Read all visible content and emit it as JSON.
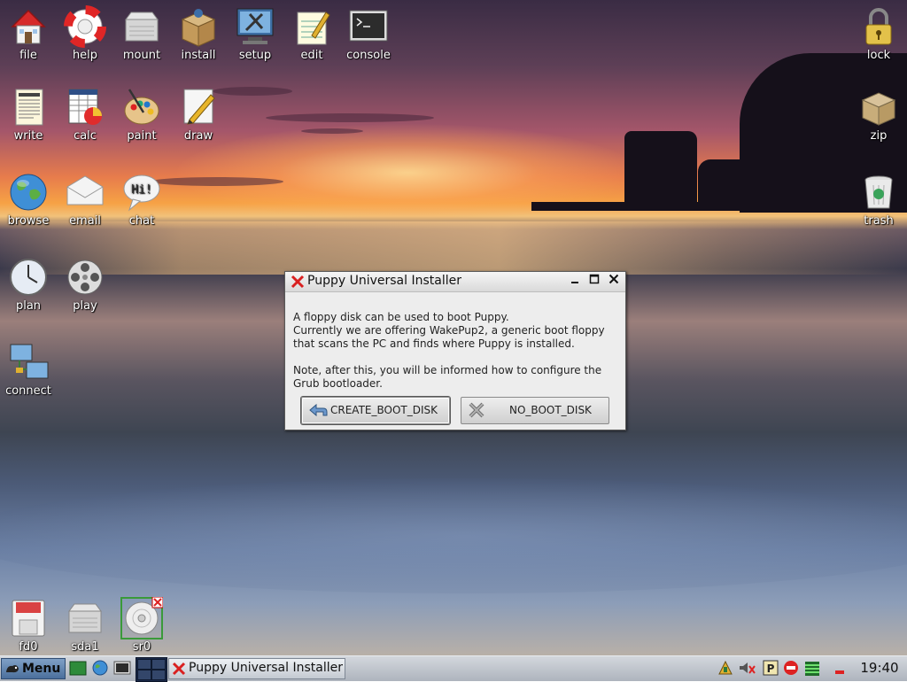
{
  "desktop": {
    "icons": [
      {
        "label": "file",
        "icon": "home-icon"
      },
      {
        "label": "help",
        "icon": "lifebuoy-icon"
      },
      {
        "label": "mount",
        "icon": "drive-icon"
      },
      {
        "label": "install",
        "icon": "package-icon"
      },
      {
        "label": "setup",
        "icon": "setup-icon"
      },
      {
        "label": "edit",
        "icon": "notepad-icon"
      },
      {
        "label": "console",
        "icon": "terminal-icon"
      },
      {
        "label": "lock",
        "icon": "padlock-icon"
      },
      {
        "label": "write",
        "icon": "document-icon"
      },
      {
        "label": "calc",
        "icon": "spreadsheet-icon"
      },
      {
        "label": "paint",
        "icon": "palette-icon"
      },
      {
        "label": "draw",
        "icon": "pencil-icon"
      },
      {
        "label": "zip",
        "icon": "box-icon"
      },
      {
        "label": "browse",
        "icon": "globe-icon"
      },
      {
        "label": "email",
        "icon": "envelope-icon"
      },
      {
        "label": "chat",
        "icon": "speech-bubble-icon"
      },
      {
        "label": "trash",
        "icon": "trash-icon"
      },
      {
        "label": "plan",
        "icon": "clock-icon"
      },
      {
        "label": "play",
        "icon": "film-reel-icon"
      },
      {
        "label": "connect",
        "icon": "network-icon"
      },
      {
        "label": "fd0",
        "icon": "floppy-icon"
      },
      {
        "label": "sda1",
        "icon": "hard-drive-icon"
      },
      {
        "label": "sr0",
        "icon": "cdrom-icon"
      }
    ]
  },
  "dialog": {
    "title": "Puppy Universal Installer",
    "message": [
      "A floppy disk can be used to boot Puppy.\nCurrently we are offering WakePup2, a generic boot floppy that scans the PC and finds where Puppy is installed.",
      "Note, after this, you will be informed how to configure the Grub bootloader."
    ],
    "buttons": {
      "create": "CREATE_BOOT_DISK",
      "no": "NO_BOOT_DISK"
    }
  },
  "taskbar": {
    "menu_label": "Menu",
    "task_label": "Puppy Universal Installer",
    "clock": "19:40"
  },
  "colors": {
    "accent_red": "#d92020",
    "taskbar_bg": "#c4c9d0",
    "dialog_bg": "#ededed"
  }
}
